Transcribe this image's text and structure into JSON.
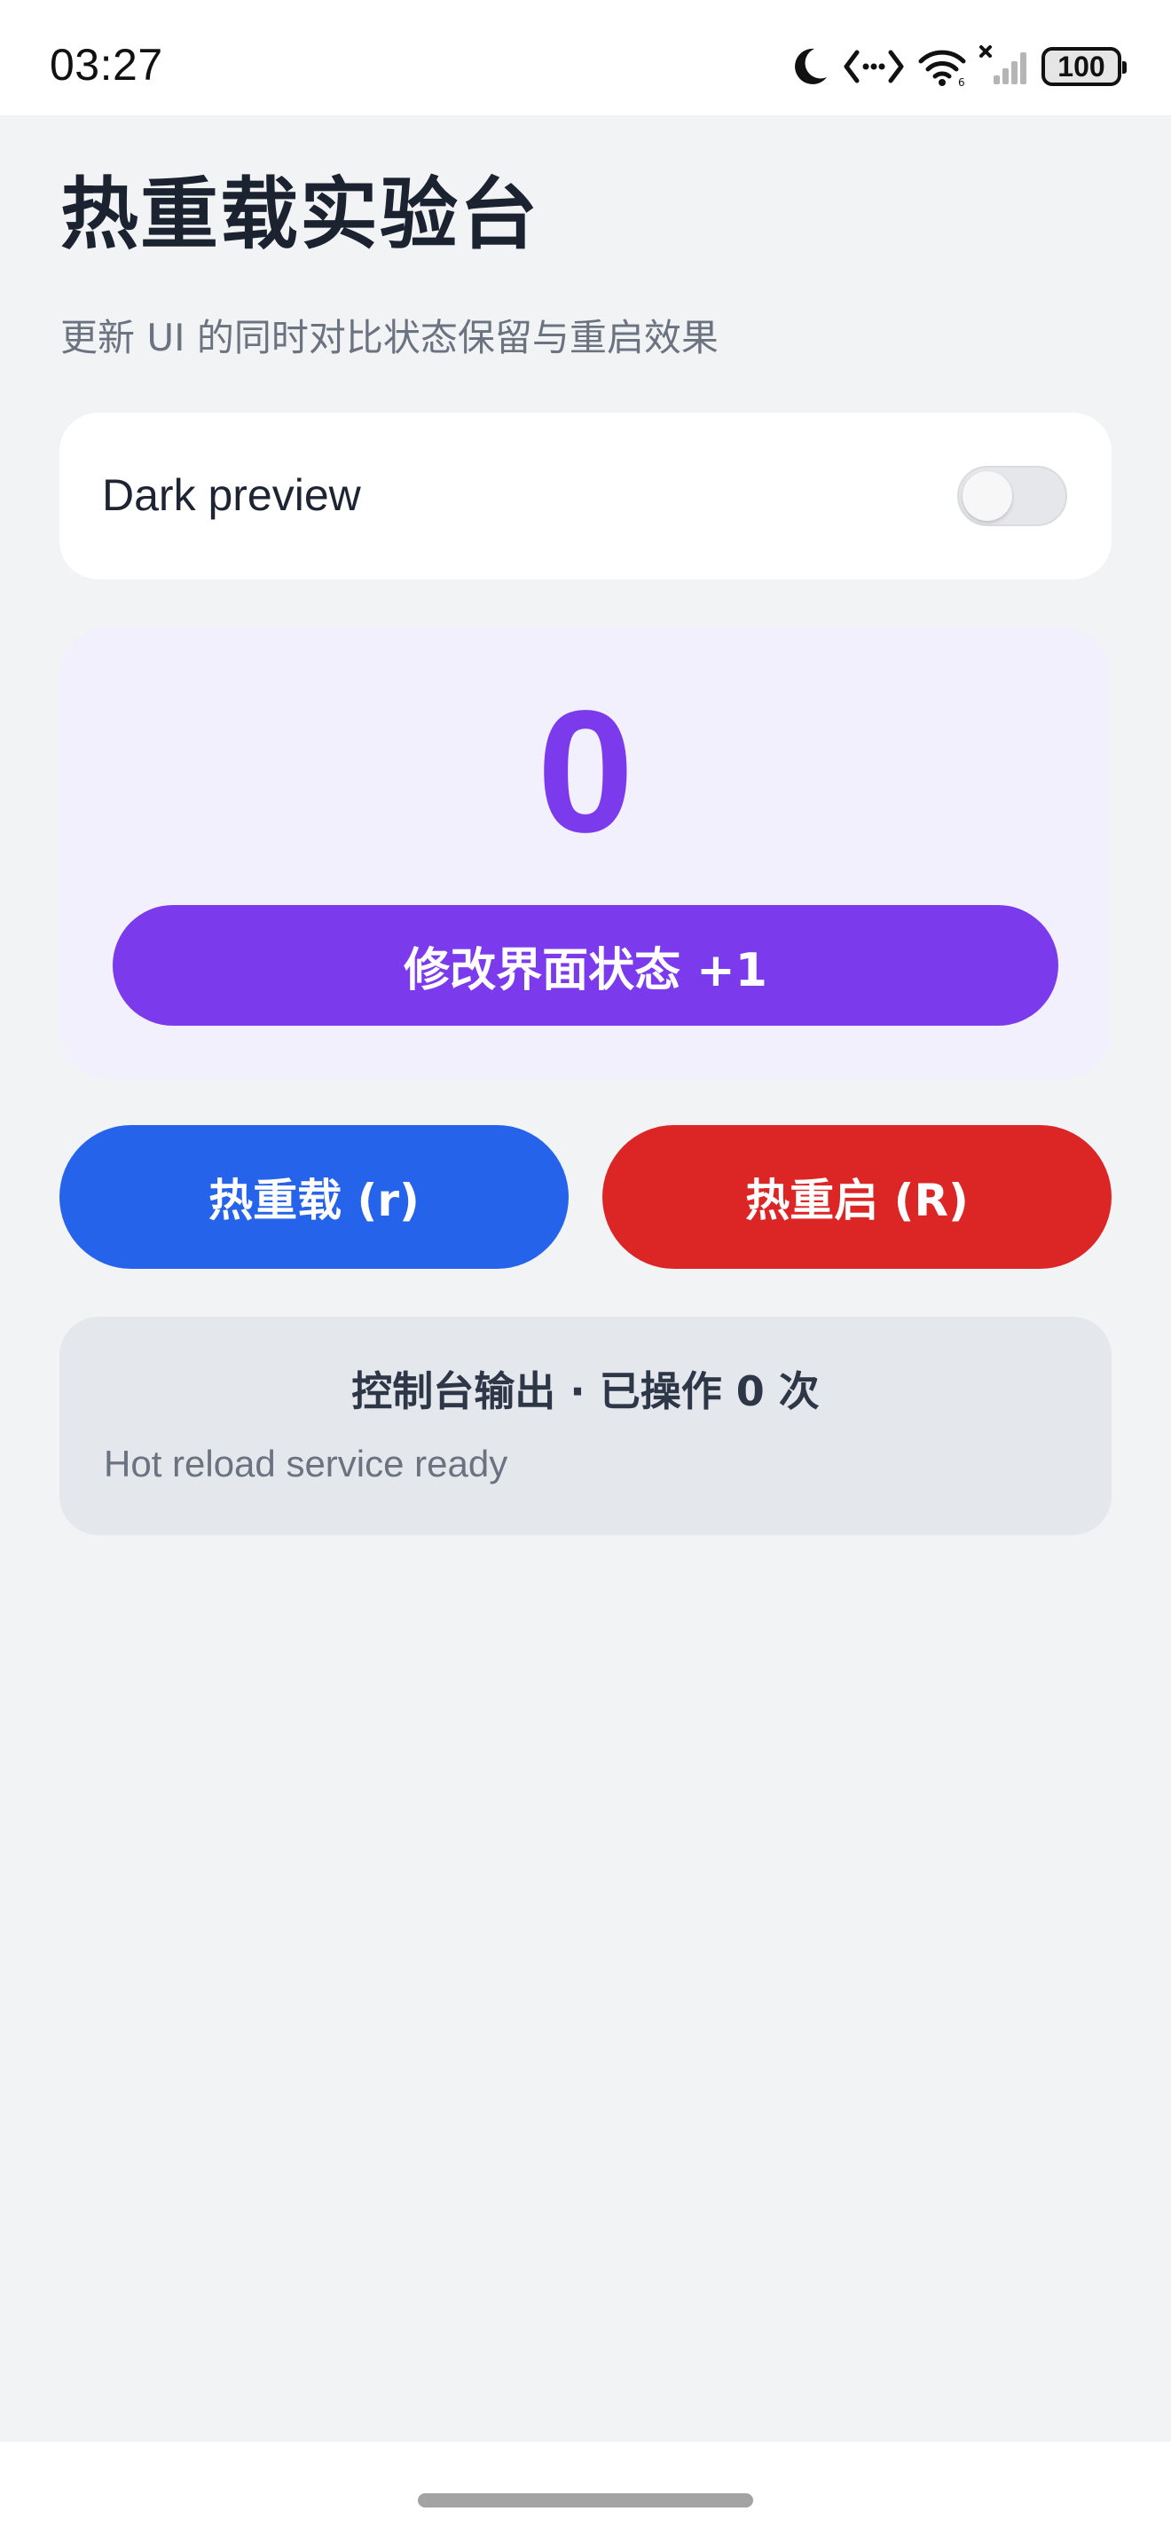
{
  "status_bar": {
    "time": "03:27",
    "battery": "100",
    "icons": [
      "moon-icon",
      "code-arrows-icon",
      "wifi-icon",
      "signal-icon",
      "battery-icon"
    ]
  },
  "header": {
    "title": "热重载实验台",
    "subtitle": "更新 UI 的同时对比状态保留与重启效果"
  },
  "dark_preview": {
    "label": "Dark preview",
    "enabled": false
  },
  "counter": {
    "value": "0",
    "increment_label": "修改界面状态 +1"
  },
  "actions": {
    "hot_reload_label": "热重载 (r)",
    "hot_restart_label": "热重启 (R)"
  },
  "console": {
    "title": "控制台输出 · 已操作 0 次",
    "log": "Hot reload service ready"
  },
  "colors": {
    "primary": "#7c3aed",
    "reload": "#2563eb",
    "restart": "#dc2626",
    "background": "#f2f3f5"
  }
}
